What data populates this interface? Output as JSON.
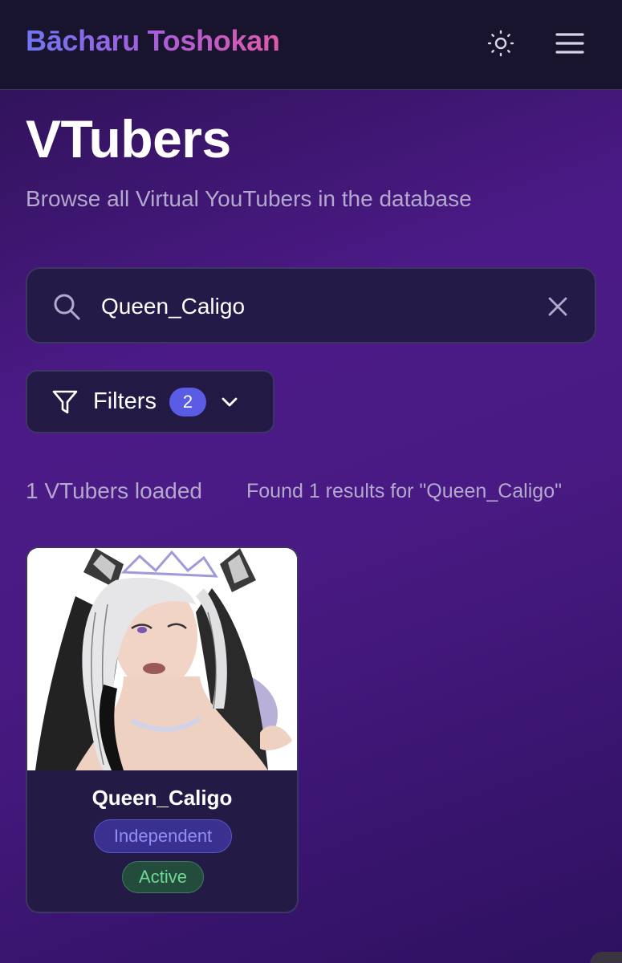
{
  "header": {
    "brand": "Bācharu Toshokan",
    "theme_icon": "sun-icon",
    "menu_icon": "hamburger-menu-icon"
  },
  "page": {
    "title": "VTubers",
    "subtitle": "Browse all Virtual YouTubers in the database"
  },
  "search": {
    "value": "Queen_Caligo",
    "placeholder": "",
    "icon": "search-icon",
    "clear_icon": "close-icon"
  },
  "filters": {
    "label": "Filters",
    "count": "2",
    "icon": "funnel-icon",
    "chevron": "chevron-down-icon"
  },
  "stats": {
    "loaded": "1 VTubers loaded",
    "results": "Found 1 results for \"Queen_Caligo\""
  },
  "results": [
    {
      "name": "Queen_Caligo",
      "organization": "Independent",
      "status": "Active"
    }
  ],
  "colors": {
    "accent": "#5b5ce6",
    "brand_gradient_start": "#6e76f0",
    "brand_gradient_end": "#e05aa8",
    "status_active": "#6fd898"
  }
}
